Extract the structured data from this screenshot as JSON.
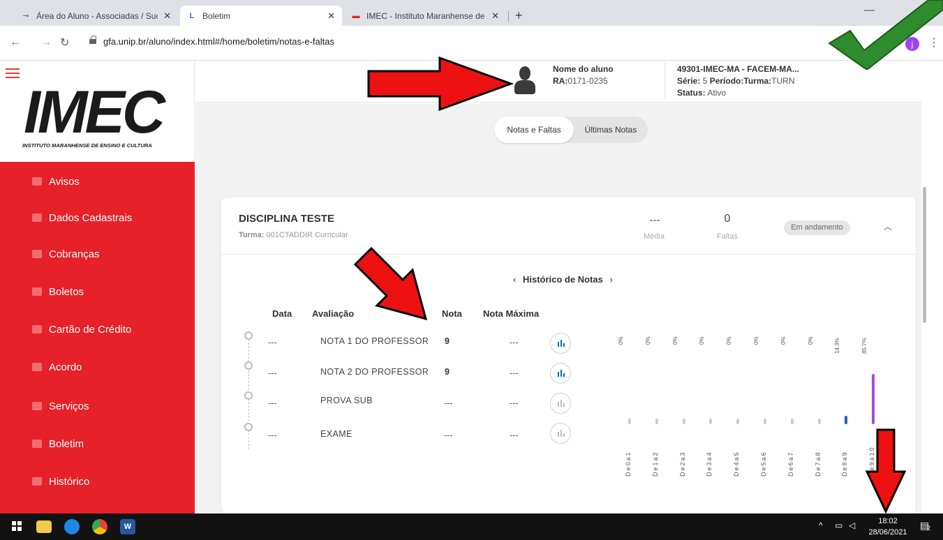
{
  "browser": {
    "tabs": [
      {
        "title": "Área do Aluno - Associadas / Suc",
        "icon": "unip-favicon",
        "active": false
      },
      {
        "title": "Boletim",
        "icon": "l-favicon",
        "active": true
      },
      {
        "title": "IMEC - Instituto Maranhense de E",
        "icon": "imec-favicon",
        "active": false
      }
    ],
    "tab_close": "✕",
    "new_tab": "+",
    "url": "gfa.unip.br/aluno/index.html#/home/boletim/notas-e-faltas",
    "profile_initial": "j",
    "win_min": "—"
  },
  "logo": {
    "text": "IMEC",
    "subtitle": "INSTITUTO MARANHENSE DE ENSINO E CULTURA"
  },
  "sidebar": {
    "items": [
      {
        "label": "Avisos",
        "icon": "bell-icon"
      },
      {
        "label": "Dados Cadastrais",
        "icon": "document-icon"
      },
      {
        "label": "Cobranças",
        "icon": "money-icon"
      },
      {
        "label": "Boletos",
        "icon": "dollar-icon"
      },
      {
        "label": "Cartão de Crédito",
        "icon": "credit-card-icon"
      },
      {
        "label": "Acordo",
        "icon": "handshake-icon"
      },
      {
        "label": "Serviços",
        "icon": "services-icon"
      },
      {
        "label": "Boletim",
        "icon": "report-card-icon"
      },
      {
        "label": "Histórico",
        "icon": "history-icon"
      }
    ]
  },
  "header": {
    "student_name": "Nome do aluno",
    "ra_label": "RA:",
    "ra_value": "0171-0235",
    "course": "49301-IMEC-MA - FACEM-MA...",
    "serie_label": "Série:",
    "serie_value": " 5 ",
    "periodo_label": "Período:",
    "turma_label": "Turma:",
    "turma_value": "TURN",
    "status_label": "Status:",
    "status_value": " Ativo"
  },
  "tabs": {
    "notas_faltas": "Notas e Faltas",
    "ultimas_notas": "Últimas Notas"
  },
  "disciplina": {
    "title": "DISCIPLINA TESTE",
    "turma_label": "Turma:",
    "turma_value": " 001CTADDIR Curricular",
    "media_value": "---",
    "media_label": "Média",
    "faltas_value": "0",
    "faltas_label": "Faltas",
    "status": "Em andamento"
  },
  "historico": {
    "prev": "‹",
    "title": "Histórico de Notas",
    "next": "›"
  },
  "table": {
    "headers": {
      "data": "Data",
      "avaliacao": "Avaliação",
      "nota": "Nota",
      "nota_maxima": "Nota Máxima"
    },
    "rows": [
      {
        "data": "---",
        "avaliacao": "NOTA 1 DO PROFESSOR",
        "nota": "9",
        "nota_maxima": "---"
      },
      {
        "data": "---",
        "avaliacao": "NOTA 2 DO PROFESSOR",
        "nota": "9",
        "nota_maxima": "---"
      },
      {
        "data": "---",
        "avaliacao": "PROVA SUB",
        "nota": "---",
        "nota_maxima": "---"
      },
      {
        "data": "---",
        "avaliacao": "EXAME",
        "nota": "---",
        "nota_maxima": "---"
      }
    ]
  },
  "chart_data": {
    "type": "bar",
    "categories": [
      "De 0 a 1",
      "De 1 a 2",
      "De 2 a 3",
      "De 3 a 4",
      "De 4 a 5",
      "De 5 a 6",
      "De 6 a 7",
      "De 7 a 8",
      "De 8 a 9",
      "De 9 a 10"
    ],
    "values": [
      0,
      0,
      0,
      0,
      0,
      0,
      0,
      0,
      14.3,
      85.7
    ],
    "labels": [
      "0%",
      "0%",
      "0%",
      "0%",
      "0%",
      "0%",
      "0%",
      "0%",
      "14.3%",
      "85.7%"
    ],
    "colors": [
      "#cccccc",
      "#cccccc",
      "#cccccc",
      "#cccccc",
      "#cccccc",
      "#cccccc",
      "#cccccc",
      "#cccccc",
      "#1565c0",
      "#a64ddb"
    ],
    "ylim": [
      0,
      100
    ]
  },
  "taskbar": {
    "time": "18:02",
    "date": "28/06/2021",
    "notifications": "2"
  },
  "colors": {
    "brand_red": "#e62129",
    "content_bg": "#f2f2f2"
  }
}
